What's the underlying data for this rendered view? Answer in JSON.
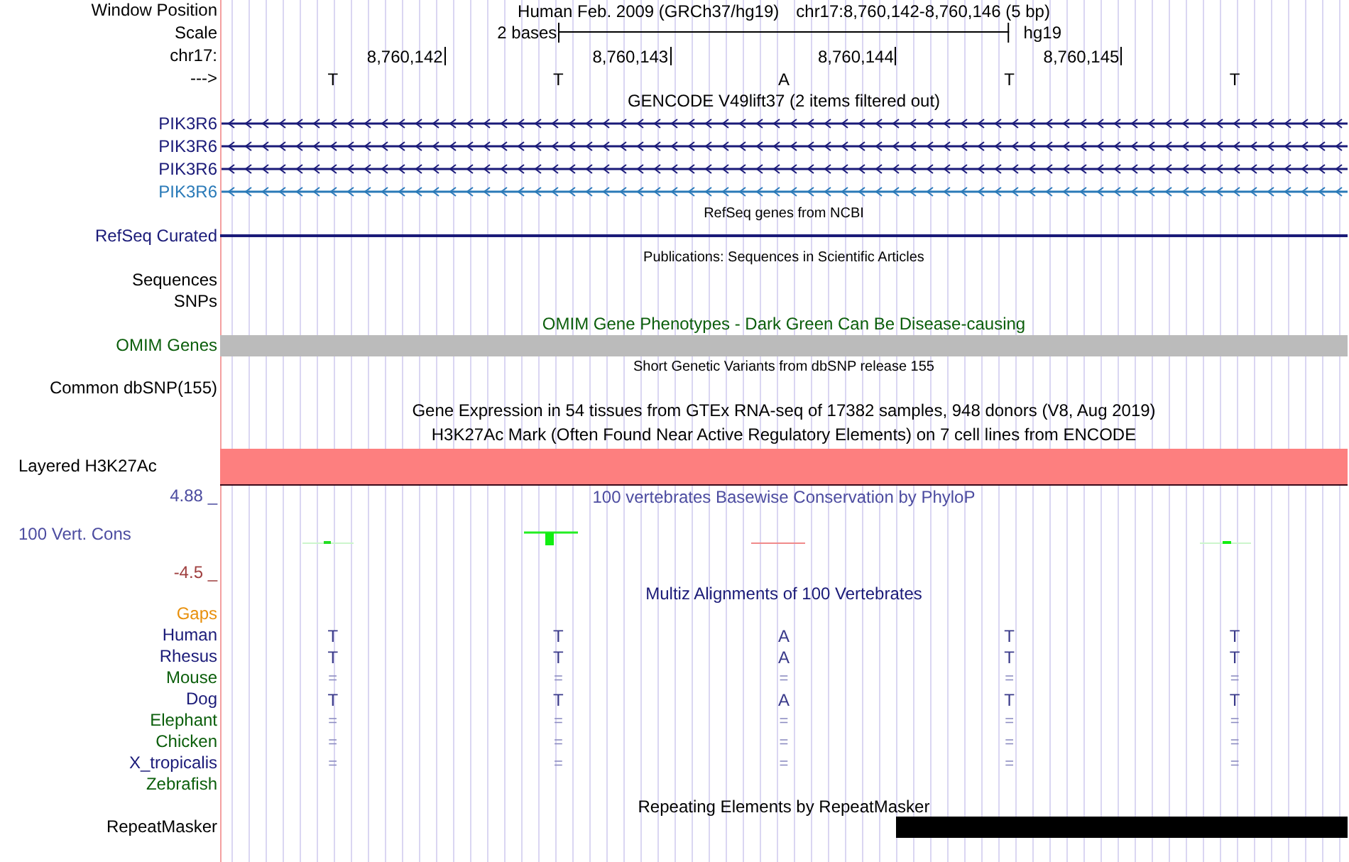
{
  "header": {
    "window_label": "Window Position",
    "assembly": "Human Feb. 2009 (GRCh37/hg19)",
    "position": "chr17:8,760,142-8,760,146 (5 bp)"
  },
  "scale": {
    "label": "Scale",
    "text": "2 bases",
    "db": "hg19"
  },
  "ruler": {
    "label": "chr17:",
    "ticks": [
      "8,760,142",
      "8,760,143",
      "8,760,144",
      "8,760,145"
    ]
  },
  "strand": {
    "label": "--->",
    "bases": [
      "T",
      "T",
      "A",
      "T",
      "T"
    ]
  },
  "rows": [
    {
      "kind": "title",
      "text": "GENCODE V49lift37 (2 items filtered out)",
      "small": false,
      "color": "#000000"
    },
    {
      "kind": "gene",
      "label": "PIK3R6",
      "color": "#1a1a78"
    },
    {
      "kind": "gene",
      "label": "PIK3R6",
      "color": "#1a1a78"
    },
    {
      "kind": "gene",
      "label": "PIK3R6",
      "color": "#1a1a78"
    },
    {
      "kind": "gene",
      "label": "PIK3R6",
      "color": "#2a7ab8"
    },
    {
      "kind": "title",
      "text": "RefSeq genes from NCBI",
      "small": true,
      "color": "#000000"
    },
    {
      "kind": "line",
      "label": "RefSeq Curated",
      "color": "#1a1a78"
    },
    {
      "kind": "title",
      "text": "Publications: Sequences in Scientific Articles",
      "small": true,
      "color": "#000000"
    },
    {
      "kind": "label",
      "label": "Sequences",
      "color": "#000000"
    },
    {
      "kind": "label",
      "label": "SNPs",
      "color": "#000000"
    },
    {
      "kind": "title",
      "text": "OMIM Gene Phenotypes - Dark Green Can Be Disease-causing",
      "small": false,
      "color": "#0b5e0b"
    },
    {
      "kind": "bar",
      "label": "OMIM Genes",
      "color": "#0b5e0b",
      "bar": {
        "color": "#bbbbbb",
        "covered": [
          true,
          true,
          true,
          true,
          true
        ]
      }
    },
    {
      "kind": "title",
      "text": "Short Genetic Variants from dbSNP release 155",
      "small": true,
      "color": "#000000"
    },
    {
      "kind": "label",
      "label": "Common dbSNP(155)",
      "color": "#000000"
    },
    {
      "kind": "title",
      "text": "Gene Expression in 54 tissues from GTEx RNA-seq of 17382 samples, 948 donors (V8, Aug 2019)",
      "small": false,
      "color": "#000000"
    },
    {
      "kind": "title",
      "text": "H3K27Ac Mark (Often Found Near Active Regulatory Elements) on 7 cell lines from ENCODE",
      "small": false,
      "color": "#000000"
    },
    {
      "kind": "layered",
      "label": "Layered H3K27Ac",
      "color": "#000000",
      "bar": {
        "color": "#fd7f7f"
      }
    },
    {
      "kind": "wiggle",
      "label": "100 Vert. Cons",
      "color": "#4c4ca0",
      "max": "4.88 _",
      "min": "-4.5 _",
      "title": "100 vertebrates Basewise Conservation by PhyloP"
    },
    {
      "kind": "title",
      "text": "Multiz Alignments of 100 Vertebrates",
      "small": false,
      "color": "#1a1a78"
    },
    {
      "kind": "label",
      "label": "Gaps",
      "color": "#e8900c"
    },
    {
      "kind": "species",
      "label": "Human",
      "color": "#1a1a78",
      "bases": [
        "T",
        "T",
        "A",
        "T",
        "T"
      ]
    },
    {
      "kind": "species",
      "label": "Rhesus",
      "color": "#1a1a78",
      "bases": [
        "T",
        "T",
        "A",
        "T",
        "T"
      ]
    },
    {
      "kind": "species",
      "label": "Mouse",
      "color": "#0b5e0b",
      "bases": [
        "=",
        "=",
        "=",
        "=",
        "="
      ]
    },
    {
      "kind": "species",
      "label": "Dog",
      "color": "#1a1a78",
      "bases": [
        "T",
        "T",
        "A",
        "T",
        "T"
      ]
    },
    {
      "kind": "species",
      "label": "Elephant",
      "color": "#0b5e0b",
      "bases": [
        "=",
        "=",
        "=",
        "=",
        "="
      ]
    },
    {
      "kind": "species",
      "label": "Chicken",
      "color": "#0b5e0b",
      "bases": [
        "=",
        "=",
        "=",
        "=",
        "="
      ]
    },
    {
      "kind": "species",
      "label": "X_tropicalis",
      "color": "#1a1a78",
      "bases": [
        "=",
        "=",
        "=",
        "=",
        "="
      ]
    },
    {
      "kind": "species",
      "label": "Zebrafish",
      "color": "#0b5e0b"
    },
    {
      "kind": "title",
      "text": "Repeating Elements by RepeatMasker",
      "small": false,
      "color": "#000000"
    },
    {
      "kind": "repeat",
      "label": "RepeatMasker",
      "color": "#000000",
      "bar": {
        "color": "#000000",
        "covered": [
          false,
          false,
          false,
          true,
          true
        ]
      }
    }
  ]
}
